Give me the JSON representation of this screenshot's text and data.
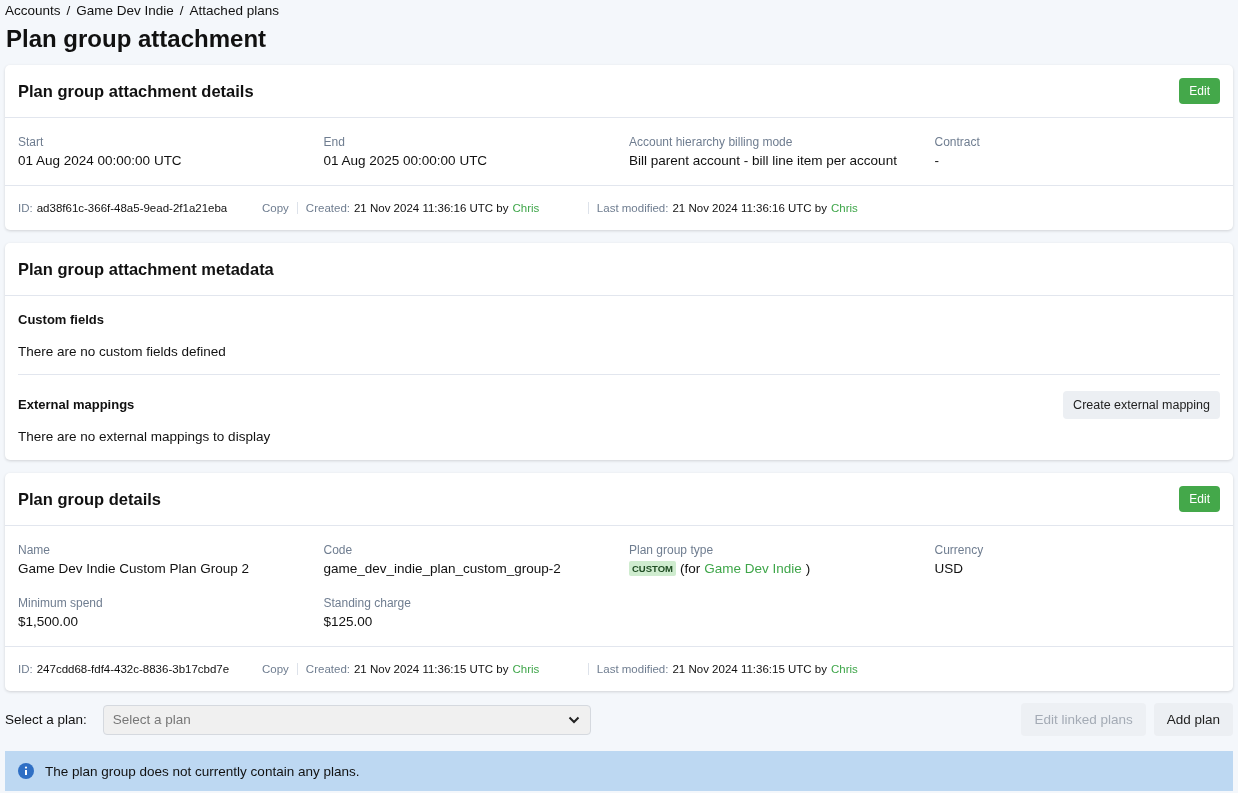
{
  "breadcrumbs": [
    "Accounts",
    "Game Dev Indie",
    "Attached plans"
  ],
  "breadcrumb_separator": "/",
  "title": "Plan group attachment",
  "attachment_details": {
    "title": "Plan group attachment details",
    "edit_button": "Edit",
    "fields": [
      {
        "kind": "text",
        "label": "Start",
        "value": "01 Aug 2024 00:00:00 UTC"
      },
      {
        "kind": "text",
        "label": "End",
        "value": "01 Aug 2025 00:00:00 UTC"
      },
      {
        "kind": "text",
        "label": "Account hierarchy billing mode",
        "value": "Bill parent account - bill line item per account"
      },
      {
        "kind": "text",
        "label": "Contract",
        "value": "-"
      }
    ],
    "meta": {
      "id_label": "ID:",
      "id": "ad38f61c-366f-48a5-9ead-2f1a21eba",
      "copy": "Copy",
      "created_label": "Created:",
      "created": "21 Nov 2024 11:36:16 UTC by",
      "created_by": "Chris",
      "modified_label": "Last modified:",
      "modified": "21 Nov 2024 11:36:16 UTC by",
      "modified_by": "Chris"
    }
  },
  "metadata": {
    "title": "Plan group attachment metadata",
    "custom_fields": {
      "heading": "Custom fields",
      "empty_text": "There are no custom fields defined"
    },
    "external_mappings": {
      "heading": "External mappings",
      "button": "Create external mapping",
      "empty_text": "There are no external mappings to display"
    }
  },
  "plan_group_details": {
    "title": "Plan group details",
    "edit_button": "Edit",
    "fields": [
      {
        "kind": "text",
        "label": "Name",
        "value": "Game Dev Indie Custom Plan Group 2"
      },
      {
        "kind": "text",
        "label": "Code",
        "value": "game_dev_indie_plan_custom_group-2"
      },
      {
        "kind": "type",
        "label": "Plan group type",
        "badge": "CUSTOM",
        "prefix": "(for",
        "link": "Game Dev Indie",
        "suffix": ")"
      },
      {
        "kind": "text",
        "label": "Currency",
        "value": "USD"
      },
      {
        "kind": "text",
        "label": "Minimum spend",
        "value": "$1,500.00"
      },
      {
        "kind": "text",
        "label": "Standing charge",
        "value": "$125.00"
      }
    ],
    "meta": {
      "id_label": "ID:",
      "id": "247cdd68-fdf4-432c-8836-3b17cbd7e",
      "copy": "Copy",
      "created_label": "Created:",
      "created": "21 Nov 2024 11:36:15 UTC by",
      "created_by": "Chris",
      "modified_label": "Last modified:",
      "modified": "21 Nov 2024 11:36:15 UTC by",
      "modified_by": "Chris"
    }
  },
  "plan_select": {
    "label": "Select a plan:",
    "placeholder": "Select a plan"
  },
  "buttons": [
    {
      "label": "Edit linked plans",
      "disabled": true
    },
    {
      "label": "Add plan",
      "disabled": false
    }
  ],
  "info_message": "The plan group does not currently contain any plans."
}
